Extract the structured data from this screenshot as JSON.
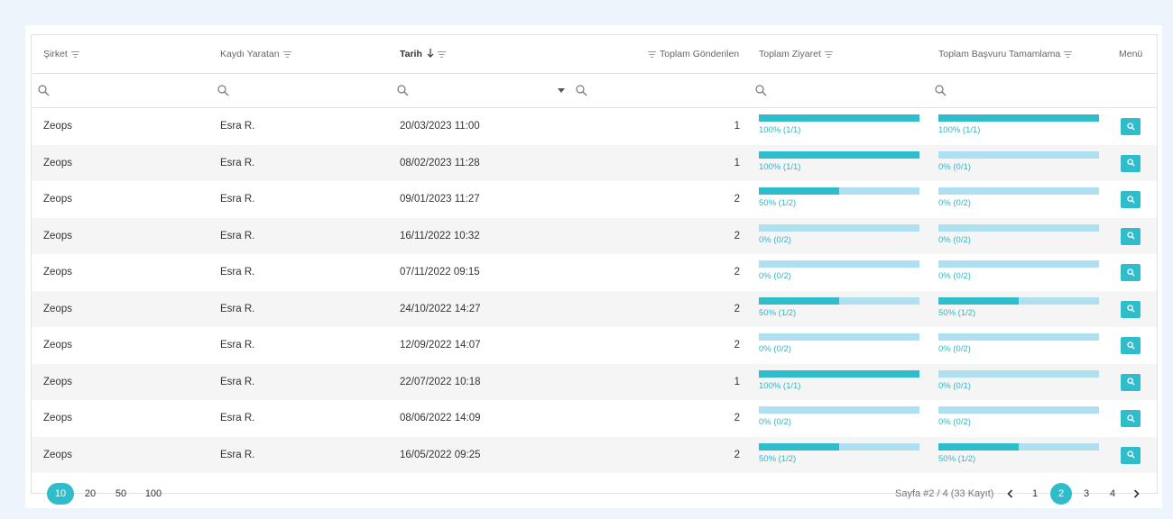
{
  "columns": {
    "company": "Şirket",
    "created_by": "Kaydı Yaratan",
    "date": "Tarih",
    "total_sent": "Toplam Gönderilen",
    "total_visit": "Toplam Ziyaret",
    "total_complete": "Toplam Başvuru Tamamlama",
    "menu": "Menü"
  },
  "rows": [
    {
      "company": "Zeops",
      "created_by": "Esra R.",
      "date": "20/03/2023 11:00",
      "sent": "1",
      "visit_pct": 1.0,
      "visit_text": "100% (1/1)",
      "complete_pct": 1.0,
      "complete_text": "100% (1/1)"
    },
    {
      "company": "Zeops",
      "created_by": "Esra R.",
      "date": "08/02/2023 11:28",
      "sent": "1",
      "visit_pct": 1.0,
      "visit_text": "100% (1/1)",
      "complete_pct": 0,
      "complete_text": "0% (0/1)"
    },
    {
      "company": "Zeops",
      "created_by": "Esra R.",
      "date": "09/01/2023 11:27",
      "sent": "2",
      "visit_pct": 0.5,
      "visit_text": "50% (1/2)",
      "complete_pct": 0,
      "complete_text": "0% (0/2)"
    },
    {
      "company": "Zeops",
      "created_by": "Esra R.",
      "date": "16/11/2022 10:32",
      "sent": "2",
      "visit_pct": 0,
      "visit_text": "0% (0/2)",
      "complete_pct": 0,
      "complete_text": "0% (0/2)"
    },
    {
      "company": "Zeops",
      "created_by": "Esra R.",
      "date": "07/11/2022 09:15",
      "sent": "2",
      "visit_pct": 0,
      "visit_text": "0% (0/2)",
      "complete_pct": 0,
      "complete_text": "0% (0/2)"
    },
    {
      "company": "Zeops",
      "created_by": "Esra R.",
      "date": "24/10/2022 14:27",
      "sent": "2",
      "visit_pct": 0.5,
      "visit_text": "50% (1/2)",
      "complete_pct": 0.5,
      "complete_text": "50% (1/2)"
    },
    {
      "company": "Zeops",
      "created_by": "Esra R.",
      "date": "12/09/2022 14:07",
      "sent": "2",
      "visit_pct": 0,
      "visit_text": "0% (0/2)",
      "complete_pct": 0,
      "complete_text": "0% (0/2)"
    },
    {
      "company": "Zeops",
      "created_by": "Esra R.",
      "date": "22/07/2022 10:18",
      "sent": "1",
      "visit_pct": 1.0,
      "visit_text": "100% (1/1)",
      "complete_pct": 0,
      "complete_text": "0% (0/1)"
    },
    {
      "company": "Zeops",
      "created_by": "Esra R.",
      "date": "08/06/2022 14:09",
      "sent": "2",
      "visit_pct": 0,
      "visit_text": "0% (0/2)",
      "complete_pct": 0,
      "complete_text": "0% (0/2)"
    },
    {
      "company": "Zeops",
      "created_by": "Esra R.",
      "date": "16/05/2022 09:25",
      "sent": "2",
      "visit_pct": 0.5,
      "visit_text": "50% (1/2)",
      "complete_pct": 0.5,
      "complete_text": "50% (1/2)"
    }
  ],
  "page_sizes": [
    "10",
    "20",
    "50",
    "100"
  ],
  "active_page_size": "10",
  "page_info": "Sayfa #2 / 4 (33 Kayıt)",
  "pages": [
    "1",
    "2",
    "3",
    "4"
  ],
  "active_page": "2",
  "colors": {
    "accent": "#30bdcb",
    "track": "#aee0f1"
  },
  "icons": {
    "filter": "filter-icon",
    "search": "search-icon",
    "sort": "arrow-down-icon",
    "dropdown": "caret-down-icon",
    "prev": "chevron-left-icon",
    "next": "chevron-right-icon",
    "row_action": "search-icon"
  }
}
